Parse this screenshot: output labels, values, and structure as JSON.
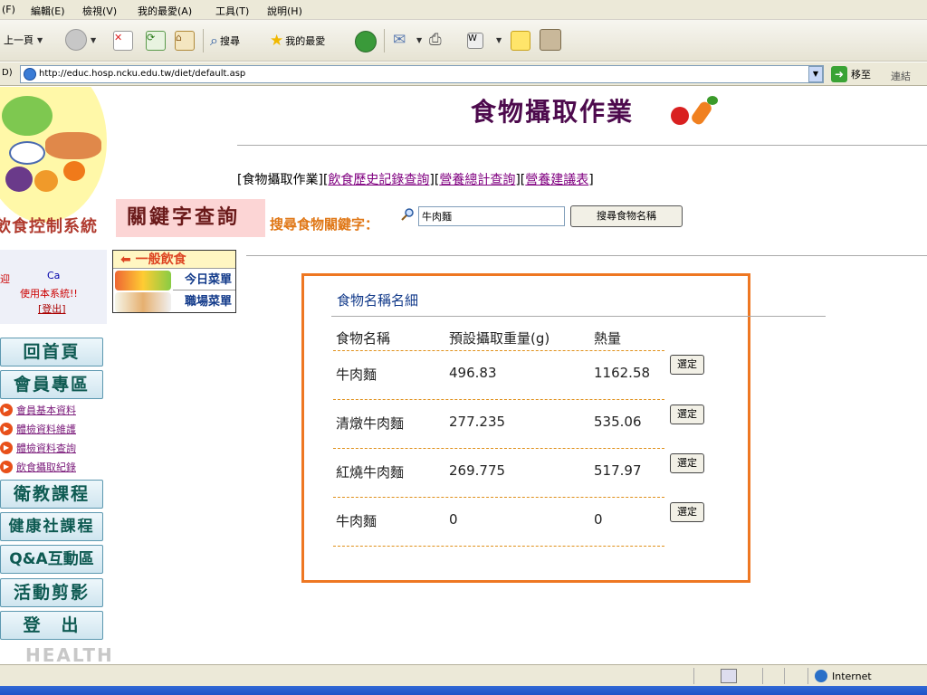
{
  "menubar": {
    "items": [
      "(F)",
      "編輯(E)",
      "檢視(V)",
      "我的最愛(A)",
      "工具(T)",
      "說明(H)"
    ]
  },
  "toolbar": {
    "back_label": "上一頁",
    "search_label": "搜尋",
    "favorites_label": "我的最愛"
  },
  "address": {
    "prefix": "D)",
    "url": "http://educ.hosp.ncku.edu.tw/diet/default.asp",
    "go_label": "移至",
    "links_label": "連結"
  },
  "sidebar": {
    "system_title": "飲食控制系統",
    "welcome_prefix": "迎",
    "user_name": "Ca",
    "welcome_text": "使用本系統!!",
    "logout_label": "[登出]",
    "nav": {
      "home": "回首頁",
      "member": "會員專區",
      "sublinks": [
        "會員基本資料",
        "體檢資料維護",
        "體檢資料查詢",
        "飲食攝取紀錄"
      ],
      "health_course": "衛教課程",
      "wellness_course": "健康社課程",
      "qa": "Q&A互動區",
      "activities": "活動剪影",
      "logout": "登　出"
    },
    "footer_text": "HEALTH"
  },
  "menus": {
    "general_diet": "一般飲食",
    "today_menu": "今日菜單",
    "work_menu": "職場菜單"
  },
  "main": {
    "title": "食物攝取作業",
    "tabs": {
      "current": "[食物攝取作業]",
      "t1": "飲食歷史記錄查詢",
      "t2": "營養總計查詢",
      "t3": "營養建議表"
    },
    "keyword_label": "關鍵字查詢",
    "search_label": "搜尋食物關鍵字：",
    "search_value": "牛肉麵",
    "search_button": "搜尋食物名稱"
  },
  "results": {
    "title": "食物名稱名細",
    "headers": [
      "食物名稱",
      "預設攝取重量(g)",
      "熱量"
    ],
    "select_label": "選定",
    "rows": [
      {
        "name": "牛肉麵",
        "weight": "496.83",
        "calories": "1162.58"
      },
      {
        "name": "清燉牛肉麵",
        "weight": "277.235",
        "calories": "535.06"
      },
      {
        "name": "紅燒牛肉麵",
        "weight": "269.775",
        "calories": "517.97"
      },
      {
        "name": "牛肉麵",
        "weight": "0",
        "calories": "0"
      }
    ]
  },
  "status": {
    "zone": "Internet"
  }
}
